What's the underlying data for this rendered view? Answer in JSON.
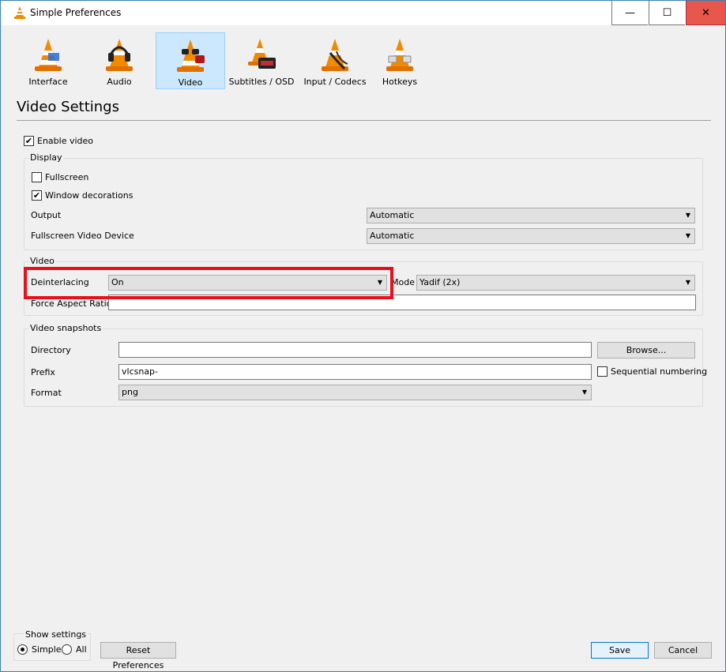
{
  "window": {
    "title": "Simple Preferences",
    "controls": {
      "minimize": "—",
      "maximize": "☐",
      "close": "✕"
    }
  },
  "toolbar": {
    "items": [
      {
        "label": "Interface",
        "icon": "interface-cone-icon"
      },
      {
        "label": "Audio",
        "icon": "audio-headphones-cone-icon"
      },
      {
        "label": "Video",
        "icon": "video-glasses-cone-icon",
        "selected": true
      },
      {
        "label": "Subtitles / OSD",
        "icon": "subtitles-clock-cone-icon"
      },
      {
        "label": "Input / Codecs",
        "icon": "input-cable-cone-icon"
      },
      {
        "label": "Hotkeys",
        "icon": "hotkeys-cone-icon"
      }
    ]
  },
  "page": {
    "title": "Video Settings"
  },
  "enable_video": {
    "label": "Enable video",
    "checked": true
  },
  "display": {
    "title": "Display",
    "fullscreen": {
      "label": "Fullscreen",
      "checked": false
    },
    "window_decorations": {
      "label": "Window decorations",
      "checked": true
    },
    "output": {
      "label": "Output",
      "value": "Automatic"
    },
    "fullscreen_device": {
      "label": "Fullscreen Video Device",
      "value": "Automatic"
    }
  },
  "video": {
    "title": "Video",
    "deinterlacing": {
      "label": "Deinterlacing",
      "value": "On"
    },
    "mode": {
      "label": "Mode",
      "value": "Yadif (2x)"
    },
    "aspect_ratio": {
      "label": "Force Aspect Ratio",
      "value": ""
    }
  },
  "snapshots": {
    "title": "Video snapshots",
    "directory": {
      "label": "Directory",
      "value": ""
    },
    "browse": "Browse...",
    "prefix": {
      "label": "Prefix",
      "value": "vlcsnap-"
    },
    "sequential": {
      "label": "Sequential numbering",
      "checked": false
    },
    "format": {
      "label": "Format",
      "value": "png"
    }
  },
  "footer": {
    "show_settings": "Show settings",
    "simple": "Simple",
    "all": "All",
    "reset": "Reset Preferences",
    "save": "Save",
    "cancel": "Cancel"
  },
  "colors": {
    "highlight": "#e8101a",
    "selected_tab": "#cce8ff",
    "close_button": "#e8564c"
  }
}
